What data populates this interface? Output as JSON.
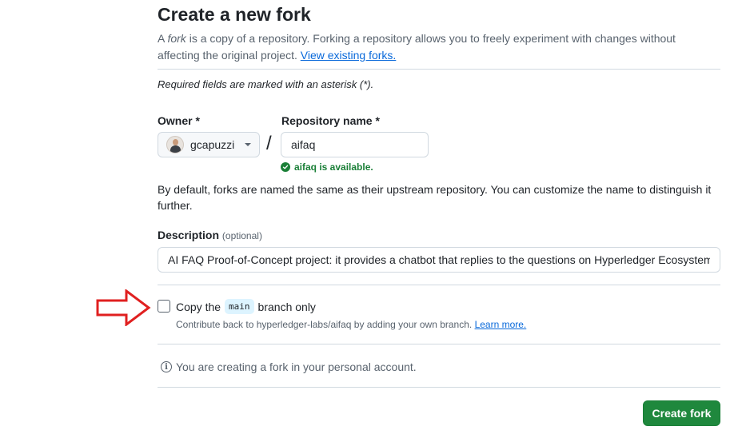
{
  "header": {
    "title": "Create a new fork",
    "subtitle_word_fork": "fork",
    "subtitle_pre": "A ",
    "subtitle_post": " is a copy of a repository. Forking a repository allows you to freely experiment with changes without affecting the original project. ",
    "view_existing_link": "View existing forks."
  },
  "form": {
    "required_note": "Required fields are marked with an asterisk (*).",
    "owner_label": "Owner *",
    "owner_value": "gcapuzzi",
    "repo_label": "Repository name *",
    "repo_value": "aifaq",
    "availability": "aifaq is available.",
    "default_note": "By default, forks are named the same as their upstream repository. You can customize the name to distinguish it further.",
    "description_label": "Description",
    "description_optional": "(optional)",
    "description_value": "AI FAQ Proof-of-Concept project: it provides a chatbot that replies to the questions on Hyperledger Ecosystem",
    "copy_main_pre": "Copy the",
    "copy_main_branch": "main",
    "copy_main_post": "branch only",
    "copy_main_checked": false,
    "contribute_text": "Contribute back to hyperledger-labs/aifaq by adding your own branch. ",
    "learn_more": "Learn more.",
    "info_text": "You are creating a fork in your personal account.",
    "submit_label": "Create fork"
  },
  "colors": {
    "accent_link": "#0969da",
    "success_green": "#1a7f37",
    "primary_button": "#1f883d",
    "annotation_arrow": "#e02020"
  },
  "icons": {
    "availability": "check-circle-icon",
    "info": "info-icon",
    "owner_dropdown": "triangle-down-icon",
    "annotation": "arrow-right-icon"
  }
}
